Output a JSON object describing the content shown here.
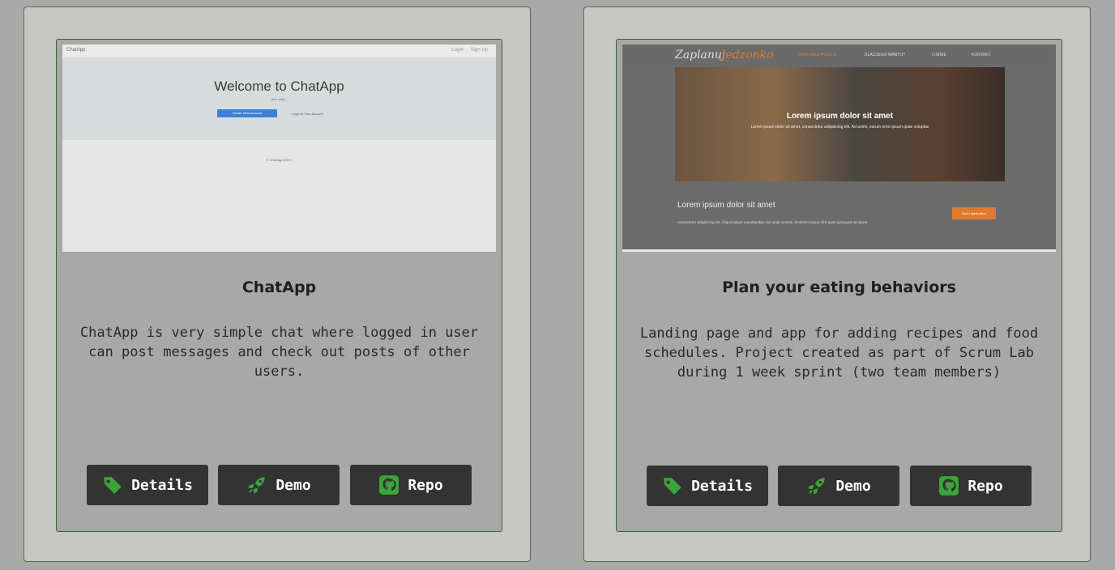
{
  "cards": [
    {
      "title": "ChatApp",
      "description": "ChatApp is very simple chat where logged in user can post messages and check out posts of other users.",
      "buttons": {
        "details": "Details",
        "demo": "Demo",
        "repo": "Repo"
      },
      "preview": {
        "brand": "ChatApp",
        "nav_login": "Login",
        "nav_signup": "Sign Up",
        "heading": "Welcome to ChatApp",
        "subheading": "let's chat...",
        "create_btn": "Create New Account",
        "login_link": "Login to Your Account",
        "footer": "© ChatApp 2020 ]"
      }
    },
    {
      "title": "Plan your eating behaviors",
      "description": "Landing page and app for adding recipes and food schedules. Project created as part of Scrum Lab during 1 week sprint (two team members)",
      "buttons": {
        "details": "Details",
        "demo": "Demo",
        "repo": "Repo"
      },
      "preview": {
        "logo_a": "Zaplanuj",
        "logo_b": "Jedzonko",
        "nav": [
          "ZAPLANUJ POSIŁKI",
          "DLACZEGO WARTO?",
          "O MNIE",
          "KONTAKT"
        ],
        "hero_title": "Lorem ipsum dolor sit amet",
        "hero_text": "Lorem ipsum dolor sit amet, consectetur adipisicing elit. Ad animi, earum error ipsum quae voluptas",
        "section_title": "Lorem ipsum dolor sit amet",
        "section_text": "consectetur adipisicing elit. Aliquid atque repudiandae sint unde veniam. Dolorem itaque nihil quas quisquam tempora.",
        "cta": "Open application"
      }
    }
  ],
  "colors": {
    "icon_green": "#3aa63a",
    "button_bg": "#333333",
    "card_bg": "#a8a8a8",
    "outer_bg": "#c6c6c5"
  }
}
